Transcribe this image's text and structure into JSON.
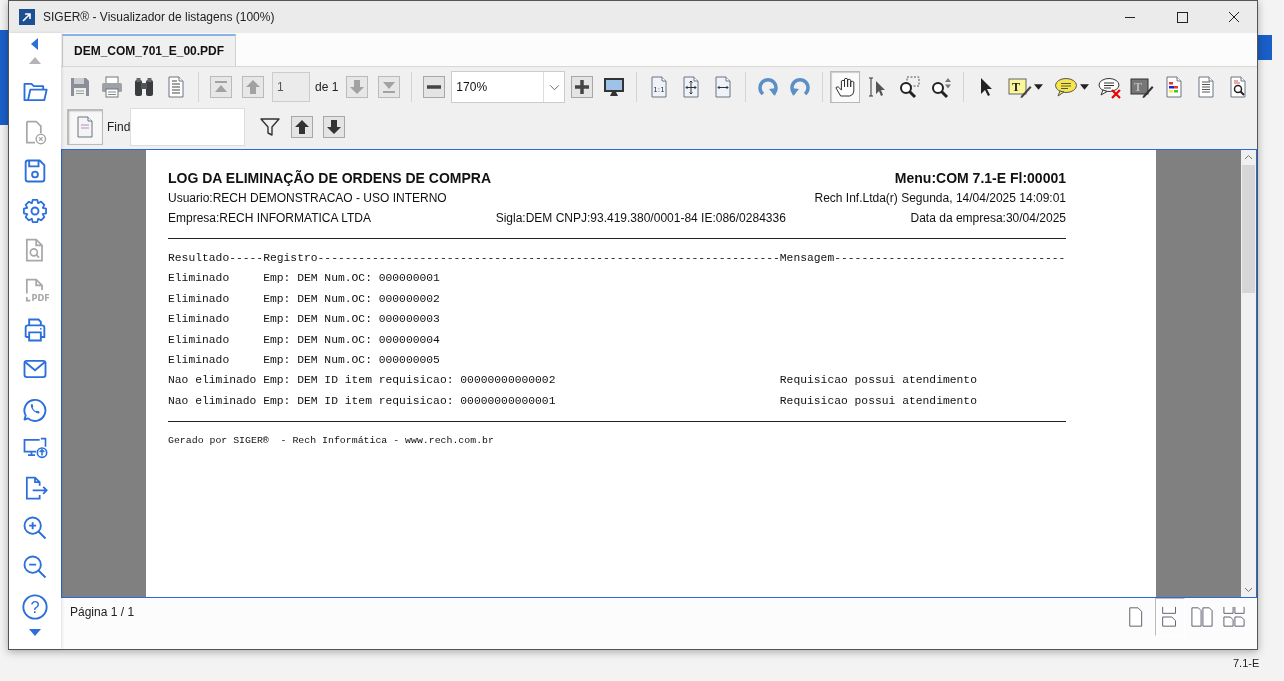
{
  "window": {
    "title": "SIGER® - Visualizador de listagens (100%)"
  },
  "sidebar": {
    "scroll_up": {
      "disabled": true
    },
    "scroll_down": {
      "disabled": false
    },
    "items": [
      {
        "kind": "folder",
        "disabled": false
      },
      {
        "kind": "file-remove",
        "disabled": true
      },
      {
        "kind": "save",
        "disabled": false
      },
      {
        "kind": "settings",
        "disabled": false
      },
      {
        "kind": "file-search",
        "disabled": true
      },
      {
        "kind": "pdf",
        "disabled": true,
        "label": "PDF"
      },
      {
        "kind": "print",
        "disabled": false
      },
      {
        "kind": "mail",
        "disabled": false
      },
      {
        "kind": "chat",
        "disabled": false
      },
      {
        "kind": "monitor-upload",
        "disabled": false
      },
      {
        "kind": "export",
        "disabled": false
      },
      {
        "kind": "zoom-in",
        "disabled": false
      },
      {
        "kind": "zoom-out",
        "disabled": false
      },
      {
        "kind": "help",
        "disabled": false,
        "label": "?"
      }
    ]
  },
  "tabs": [
    {
      "label": "DEM_COM_701_E_00.PDF",
      "selected": true
    }
  ],
  "toolbar": [
    [
      {
        "kind": "save",
        "disabled": false,
        "selected": false,
        "dropdown": false
      },
      {
        "kind": "print",
        "disabled": false,
        "selected": false,
        "dropdown": false
      },
      {
        "kind": "binoculars",
        "disabled": false,
        "selected": false,
        "dropdown": false
      },
      {
        "kind": "report",
        "disabled": false,
        "selected": false,
        "dropdown": false
      }
    ],
    [
      {
        "kind": "first",
        "disabled": true,
        "selected": false,
        "dropdown": false
      },
      {
        "kind": "previous",
        "disabled": true,
        "selected": false,
        "dropdown": false
      },
      {
        "kind": "page-field",
        "value": "1",
        "suffix": "de 1"
      },
      {
        "kind": "next",
        "disabled": true,
        "selected": false,
        "dropdown": false
      },
      {
        "kind": "last",
        "disabled": true,
        "selected": false,
        "dropdown": false
      }
    ],
    [
      {
        "kind": "zoom-out",
        "disabled": false,
        "selected": false,
        "dropdown": false
      },
      {
        "kind": "zoom-combo",
        "value": "170%"
      },
      {
        "kind": "zoom-in",
        "disabled": false,
        "selected": false,
        "dropdown": false
      },
      {
        "kind": "screen",
        "disabled": false,
        "selected": false,
        "dropdown": false
      }
    ],
    [
      {
        "kind": "actual-size",
        "disabled": false,
        "selected": false,
        "dropdown": false,
        "label": "1:1"
      },
      {
        "kind": "fit-page",
        "disabled": false,
        "selected": false,
        "dropdown": false
      },
      {
        "kind": "fit-width",
        "disabled": false,
        "selected": false,
        "dropdown": false
      }
    ],
    [
      {
        "kind": "rotate-right",
        "disabled": false,
        "selected": false,
        "dropdown": false
      },
      {
        "kind": "rotate-left",
        "disabled": false,
        "selected": false,
        "dropdown": false
      }
    ],
    [
      {
        "kind": "hand",
        "disabled": false,
        "selected": true,
        "dropdown": false
      },
      {
        "kind": "text-select",
        "disabled": false,
        "selected": false,
        "dropdown": false
      },
      {
        "kind": "zoom-area",
        "disabled": false,
        "selected": false,
        "dropdown": false
      },
      {
        "kind": "zoom-dynamic",
        "disabled": false,
        "selected": false,
        "dropdown": false
      }
    ],
    [
      {
        "kind": "pointer",
        "disabled": false,
        "selected": false,
        "dropdown": false
      },
      {
        "kind": "text-note",
        "disabled": false,
        "selected": false,
        "dropdown": true,
        "label": "T"
      },
      {
        "kind": "comment",
        "disabled": false,
        "selected": false,
        "dropdown": true
      },
      {
        "kind": "delete-comment",
        "disabled": false,
        "selected": false,
        "dropdown": false
      },
      {
        "kind": "edit-text",
        "disabled": false,
        "selected": false,
        "dropdown": false,
        "label": "T"
      },
      {
        "kind": "colors",
        "disabled": false,
        "selected": false,
        "dropdown": false
      },
      {
        "kind": "page",
        "disabled": false,
        "selected": false,
        "dropdown": false
      },
      {
        "kind": "page-search",
        "disabled": false,
        "selected": false,
        "dropdown": false
      }
    ]
  ],
  "find_bar": {
    "toggle_selected": true,
    "label": "Find",
    "buttons": [
      {
        "kind": "filter"
      },
      {
        "kind": "previous"
      },
      {
        "kind": "next"
      }
    ]
  },
  "document": {
    "title": "LOG DA ELIMINAÇÃO DE ORDENS DE COMPRA",
    "menu": "Menu:COM 7.1-E Fl:00001",
    "user": "Usuario:RECH DEMONSTRACAO - USO INTERNO",
    "timestamp": "Rech Inf.Ltda(r)  Segunda, 14/04/2025 14:09:01",
    "company": "Empresa:RECH INFORMATICA LTDA",
    "ids": "Sigla:DEM CNPJ:93.419.380/0001-84 IE:086/0284336",
    "company_date": "Data da empresa:30/04/2025",
    "column_header": "Resultado-----Registro--------------------------------------------------------------------Mensagem----------------------------------",
    "rows": [
      {
        "result": "Eliminado",
        "record": "Emp: DEM Num.OC: 000000001"
      },
      {
        "result": "Eliminado",
        "record": "Emp: DEM Num.OC: 000000002"
      },
      {
        "result": "Eliminado",
        "record": "Emp: DEM Num.OC: 000000003"
      },
      {
        "result": "Eliminado",
        "record": "Emp: DEM Num.OC: 000000004"
      },
      {
        "result": "Eliminado",
        "record": "Emp: DEM Num.OC: 000000005"
      },
      {
        "result": "Nao eliminado",
        "record": "Emp: DEM ID item requisicao: 00000000000002",
        "message": "Requisicao possui atendimento"
      },
      {
        "result": "Nao eliminado",
        "record": "Emp: DEM ID item requisicao: 00000000000001",
        "message": "Requisicao possui atendimento"
      }
    ],
    "footer": "Gerado por SIGER®  - Rech Informática - www.rech.com.br"
  },
  "status": {
    "page": "Página 1 / 1"
  },
  "view_modes": [
    {
      "kind": "single",
      "selected": false
    },
    {
      "kind": "continuous",
      "selected": true
    },
    {
      "kind": "facing",
      "selected": false
    },
    {
      "kind": "facing-continuous",
      "selected": false
    }
  ],
  "background": {
    "text": "7.1-E"
  }
}
